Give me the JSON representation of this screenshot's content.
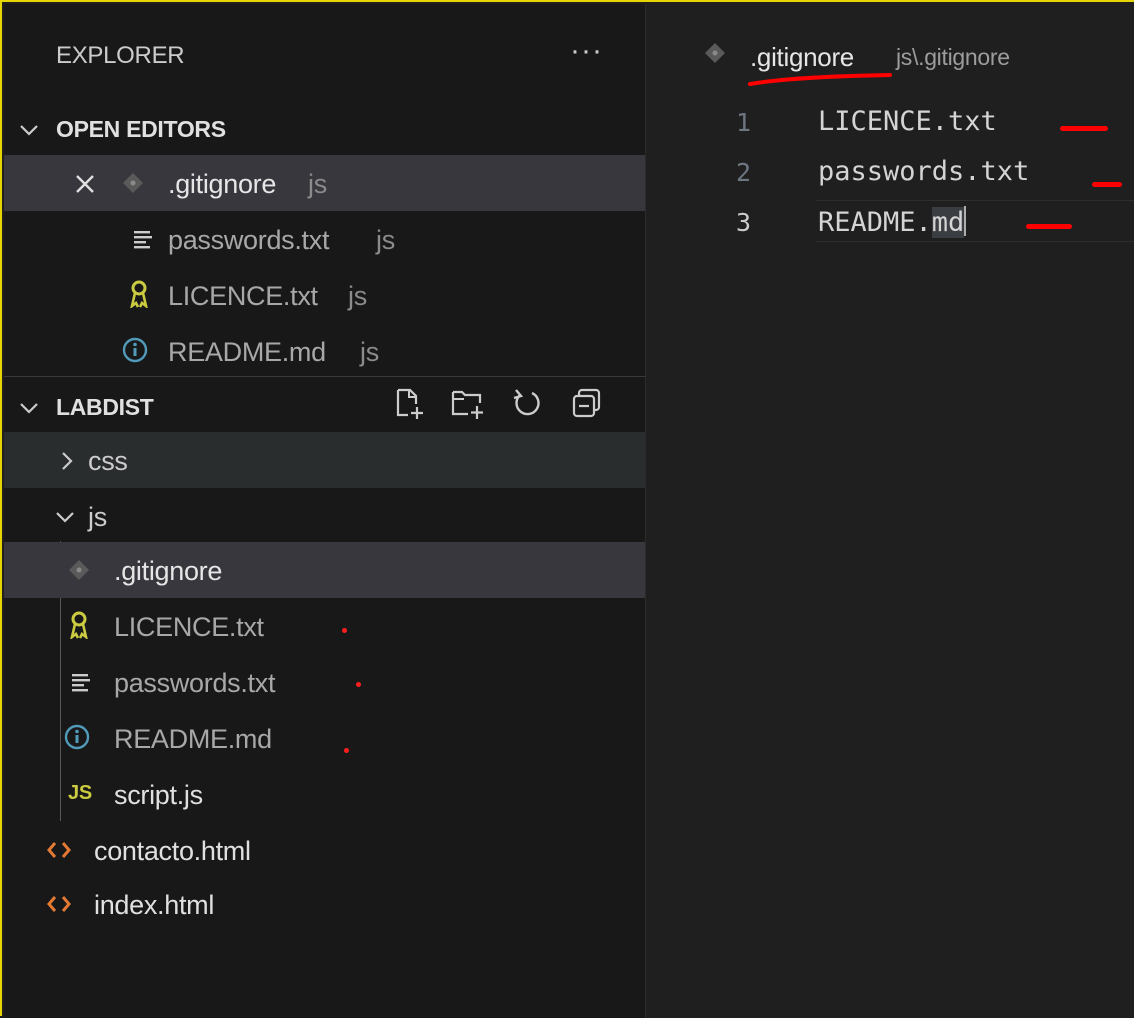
{
  "explorer": {
    "title": "EXPLORER",
    "more": "···"
  },
  "open_editors": {
    "header": "OPEN EDITORS",
    "items": [
      {
        "name": ".gitignore",
        "folder": "js",
        "icon": "gitignore-icon",
        "active": true
      },
      {
        "name": "passwords.txt",
        "folder": "js",
        "icon": "text-file-icon"
      },
      {
        "name": "LICENCE.txt",
        "folder": "js",
        "icon": "license-key-icon"
      },
      {
        "name": "README.md",
        "folder": "js",
        "icon": "info-icon"
      }
    ]
  },
  "workspace": {
    "header": "LABDIST",
    "tree": [
      {
        "name": "css",
        "type": "folder",
        "expanded": false
      },
      {
        "name": "js",
        "type": "folder",
        "expanded": true
      },
      {
        "name": ".gitignore",
        "type": "file"
      },
      {
        "name": "LICENCE.txt",
        "type": "file"
      },
      {
        "name": "passwords.txt",
        "type": "file"
      },
      {
        "name": "README.md",
        "type": "file"
      },
      {
        "name": "script.js",
        "type": "file",
        "badge": "JS"
      },
      {
        "name": "contacto.html",
        "type": "file"
      },
      {
        "name": "index.html",
        "type": "file"
      }
    ]
  },
  "editor": {
    "breadcrumb_file": ".gitignore",
    "breadcrumb_path": "js\\.gitignore",
    "lines": [
      {
        "number": "1",
        "text": "LICENCE.txt"
      },
      {
        "number": "2",
        "text": "passwords.txt"
      },
      {
        "number": "3",
        "text_main": "README.",
        "text_sel": "md"
      }
    ]
  },
  "colors": {
    "accent_yellow": "#e6d500",
    "annotation_red": "#ff0000",
    "selection_bg": "#37373d",
    "html_icon": "#e37933",
    "js_badge": "#cbcb41",
    "info_icon": "#519aba"
  }
}
